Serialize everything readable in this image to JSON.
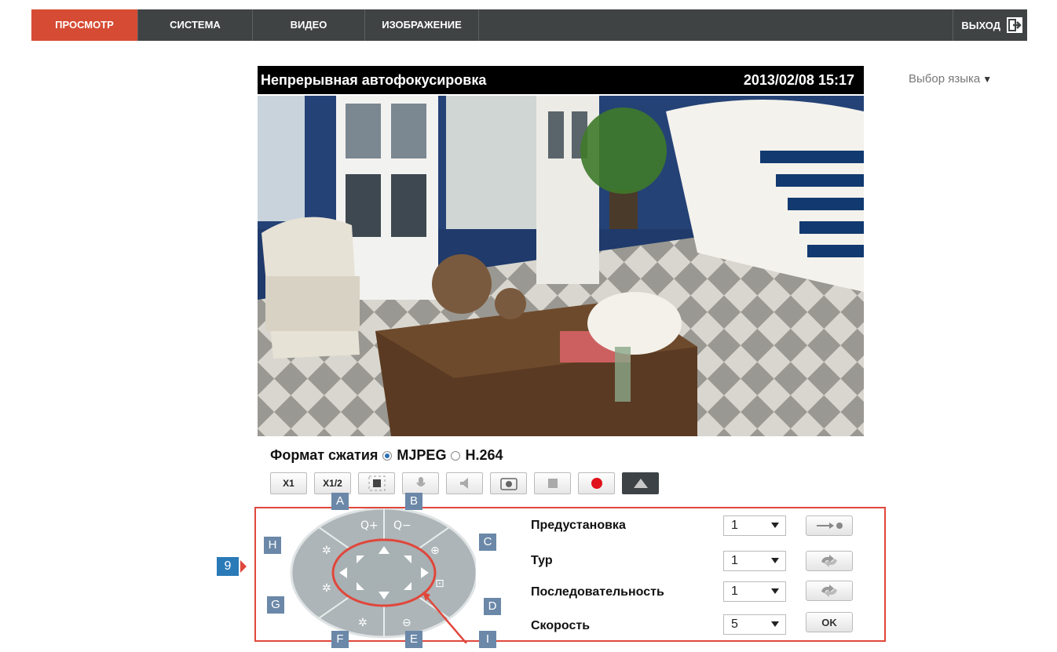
{
  "nav": {
    "tabs": [
      "ПРОСМОТР",
      "СИСТЕМА",
      "ВИДЕО",
      "ИЗОБРАЖЕНИЕ"
    ],
    "active_tab": "ПРОСМОТР",
    "logout_label": "ВЫХОД"
  },
  "language": {
    "label": "Выбор языка"
  },
  "video": {
    "title": "Непрерывная автофокусировка",
    "datetime": "2013/02/08 15:17"
  },
  "format": {
    "label": "Формат сжатия",
    "options": [
      "MJPEG",
      "H.264"
    ],
    "selected": "MJPEG"
  },
  "toolbar": {
    "buttons": [
      {
        "label": "X1"
      },
      {
        "label": "X1/2"
      },
      {
        "icon": "fullscreen-icon"
      },
      {
        "icon": "microphone-icon"
      },
      {
        "icon": "speaker-icon"
      },
      {
        "icon": "snapshot-icon"
      },
      {
        "icon": "stop-icon"
      },
      {
        "icon": "record-icon"
      },
      {
        "icon": "collapse-triangle-icon"
      }
    ]
  },
  "ptz": {
    "callout_number": "9",
    "markers": [
      "A",
      "B",
      "C",
      "D",
      "E",
      "F",
      "G",
      "H",
      "I"
    ],
    "wheel_icons": [
      "zoom-in-icon",
      "zoom-out-icon",
      "focus-far-icon",
      "focus-auto-icon",
      "focus-near-icon",
      "iris-open-icon",
      "iris-auto-icon",
      "iris-close-icon"
    ],
    "rows": [
      {
        "label": "Предустановка",
        "value": "1",
        "action_icon": "go-to-preset-icon"
      },
      {
        "label": "Тур",
        "value": "1",
        "action_icon": "cycle-icon"
      },
      {
        "label": "Последовательность",
        "value": "1",
        "action_icon": "cycle-icon"
      },
      {
        "label": "Скорость",
        "value": "5",
        "action_label": "OK"
      }
    ]
  },
  "colors": {
    "nav_bg": "#3f4344",
    "nav_active": "#d64b33",
    "highlight_red": "#e0473b",
    "marker_bg": "#6b88a8",
    "callout_blue": "#2a7ab8"
  }
}
